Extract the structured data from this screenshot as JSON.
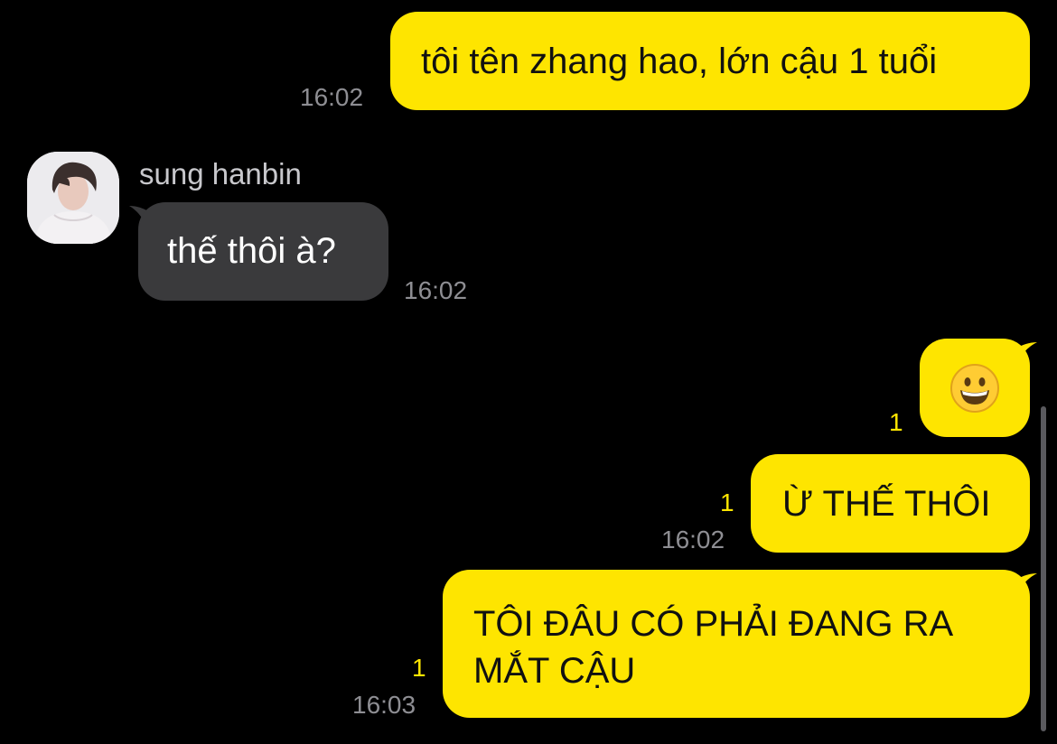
{
  "colors": {
    "background": "#000000",
    "outgoing_bubble": "#FEE500",
    "incoming_bubble": "#3A3A3C",
    "timestamp": "#8E8E93",
    "unread_count": "#FEE500"
  },
  "messages": [
    {
      "direction": "outgoing",
      "text": "tôi tên zhang hao, lớn cậu 1 tuổi",
      "time": "16:02"
    },
    {
      "direction": "incoming",
      "sender": "sung hanbin",
      "avatar": "avatar-photo",
      "text": "thế thôi à?",
      "time": "16:02"
    },
    {
      "direction": "outgoing",
      "emoji": "😀",
      "emoji_icon": "grinning-face-emoji",
      "unread": "1"
    },
    {
      "direction": "outgoing",
      "text": "Ừ THẾ THÔI",
      "unread": "1",
      "time": "16:02"
    },
    {
      "direction": "outgoing",
      "lines": [
        "TÔI ĐÂU CÓ PHẢI ĐANG RA",
        "MẮT CẬU"
      ],
      "unread": "1",
      "time": "16:03"
    }
  ]
}
